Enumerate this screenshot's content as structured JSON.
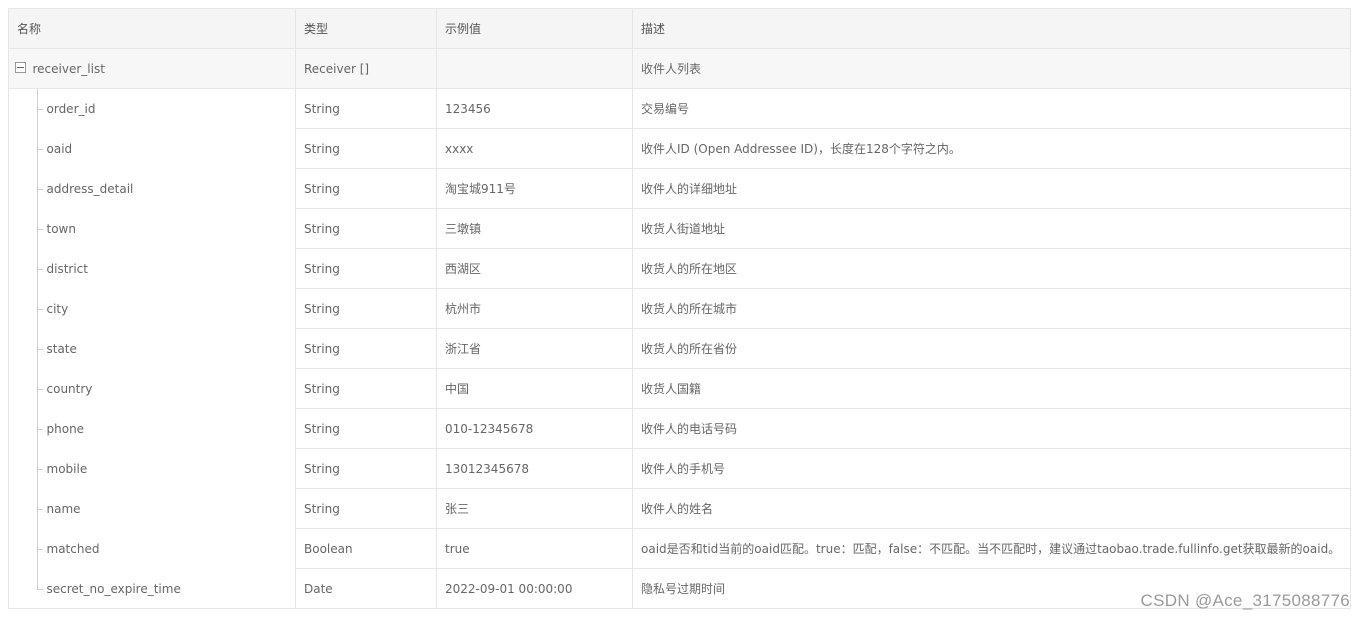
{
  "table": {
    "headers": [
      "名称",
      "类型",
      "示例值",
      "描述"
    ],
    "parent": {
      "name": "receiver_list",
      "type": "Receiver []",
      "example": "",
      "desc": "收件人列表"
    },
    "rows": [
      {
        "name": "order_id",
        "type": "String",
        "example": "123456",
        "desc": "交易编号"
      },
      {
        "name": "oaid",
        "type": "String",
        "example": "xxxx",
        "desc": "收件人ID (Open Addressee ID)，长度在128个字符之内。"
      },
      {
        "name": "address_detail",
        "type": "String",
        "example": "淘宝城911号",
        "desc": "收件人的详细地址"
      },
      {
        "name": "town",
        "type": "String",
        "example": "三墩镇",
        "desc": "收货人街道地址"
      },
      {
        "name": "district",
        "type": "String",
        "example": "西湖区",
        "desc": "收货人的所在地区"
      },
      {
        "name": "city",
        "type": "String",
        "example": "杭州市",
        "desc": "收货人的所在城市"
      },
      {
        "name": "state",
        "type": "String",
        "example": "浙江省",
        "desc": "收货人的所在省份"
      },
      {
        "name": "country",
        "type": "String",
        "example": "中国",
        "desc": "收货人国籍"
      },
      {
        "name": "phone",
        "type": "String",
        "example": "010-12345678",
        "desc": "收件人的电话号码"
      },
      {
        "name": "mobile",
        "type": "String",
        "example": "13012345678",
        "desc": "收件人的手机号"
      },
      {
        "name": "name",
        "type": "String",
        "example": "张三",
        "desc": "收件人的姓名"
      },
      {
        "name": "matched",
        "type": "Boolean",
        "example": "true",
        "desc": "oaid是否和tid当前的oaid匹配。true：匹配，false：不匹配。当不匹配时，建议通过taobao.trade.fullinfo.get获取最新的oaid。"
      },
      {
        "name": "secret_no_expire_time",
        "type": "Date",
        "example": "2022-09-01 00:00:00",
        "desc": "隐私号过期时间"
      }
    ]
  },
  "watermark": "CSDN @Ace_3175088776"
}
